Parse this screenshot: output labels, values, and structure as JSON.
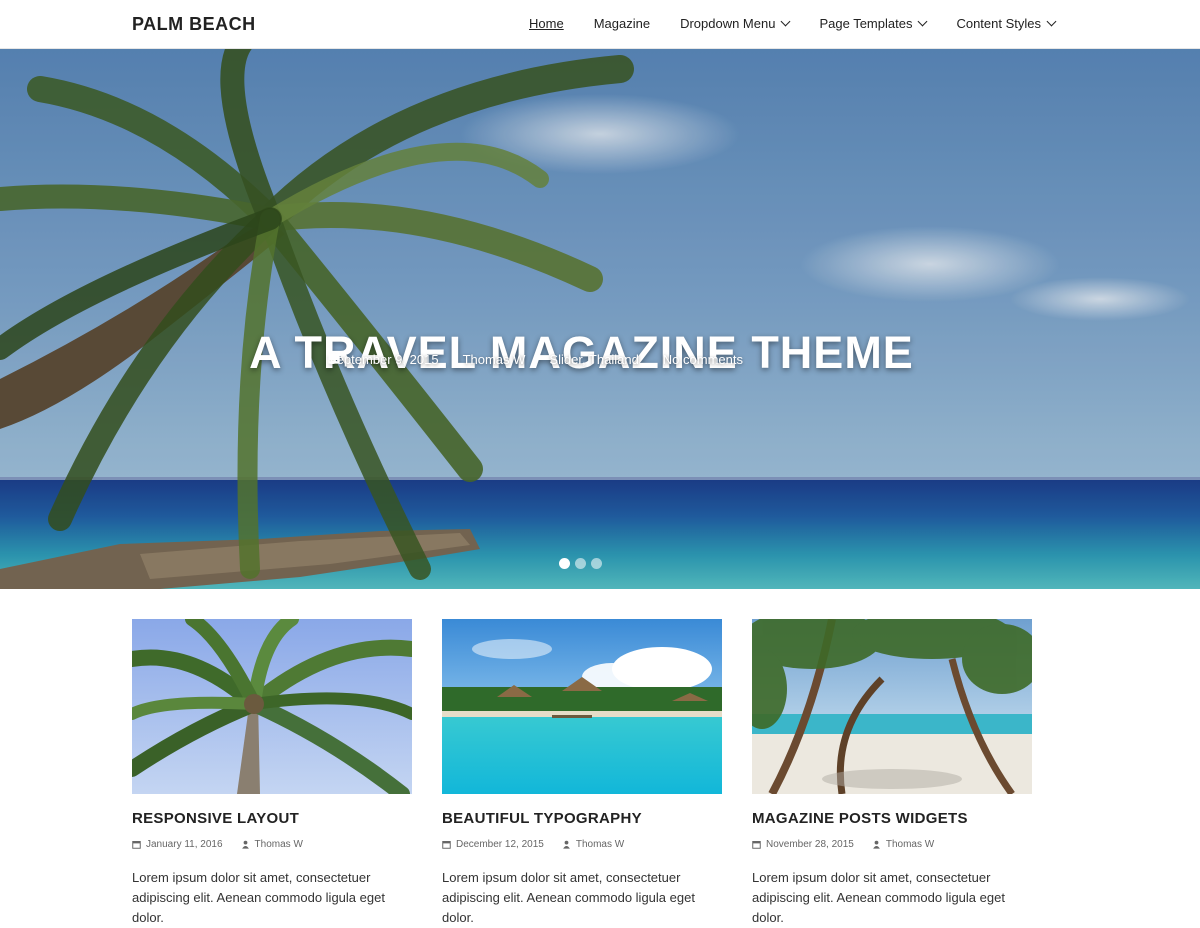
{
  "header": {
    "site_title": "PALM BEACH",
    "nav": [
      {
        "label": "Home",
        "active": true,
        "has_dropdown": false
      },
      {
        "label": "Magazine",
        "active": false,
        "has_dropdown": false
      },
      {
        "label": "Dropdown Menu",
        "active": false,
        "has_dropdown": true
      },
      {
        "label": "Page Templates",
        "active": false,
        "has_dropdown": true
      },
      {
        "label": "Content Styles",
        "active": false,
        "has_dropdown": true
      }
    ]
  },
  "hero": {
    "title": "A TRAVEL MAGAZINE THEME",
    "date": "September 9, 2015",
    "author": "Thomas W",
    "categories": "Slider, Thailand",
    "comments": "No comments",
    "slides_total": 3,
    "active_slide": 1
  },
  "posts": [
    {
      "title": "RESPONSIVE LAYOUT",
      "date": "January 11, 2016",
      "author": "Thomas W",
      "excerpt": "Lorem ipsum dolor sit amet, consectetuer adipiscing elit. Aenean commodo ligula eget dolor."
    },
    {
      "title": "BEAUTIFUL TYPOGRAPHY",
      "date": "December 12, 2015",
      "author": "Thomas W",
      "excerpt": "Lorem ipsum dolor sit amet, consectetuer adipiscing elit. Aenean commodo ligula eget dolor."
    },
    {
      "title": "MAGAZINE POSTS WIDGETS",
      "date": "November 28, 2015",
      "author": "Thomas W",
      "excerpt": "Lorem ipsum dolor sit amet, consectetuer adipiscing elit. Aenean commodo ligula eget dolor."
    }
  ],
  "icons": {
    "calendar": "calendar-icon",
    "user": "user-icon",
    "folder": "folder-icon",
    "comment": "comment-icon"
  }
}
